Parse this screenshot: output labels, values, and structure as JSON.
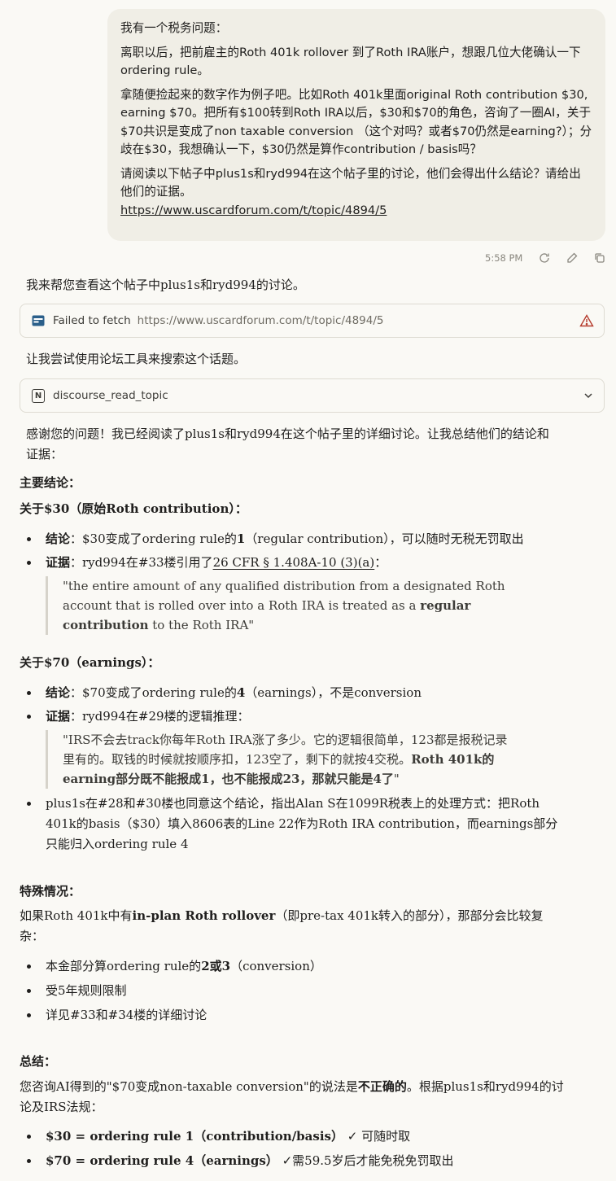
{
  "user_message": {
    "line1": "我有一个税务问题：",
    "para2": "离职以后，把前雇主的Roth 401k rollover 到了Roth IRA账户，想跟几位大佬确认一下ordering rule。",
    "para3": "拿随便捡起来的数字作为例子吧。比如Roth 401k里面original Roth contribution $30, earning $70。把所有$100转到Roth IRA以后，$30和$70的角色，咨询了一圈AI，关于$70共识是变成了non taxable conversion （这个对吗？或者$70仍然是earning?）；分歧在$30，我想确认一下，$30仍然是算作contribution / basis吗？",
    "para4": "请阅读以下帖子中plus1s和ryd994在这个帖子里的讨论，他们会得出什么结论？请给出他们的证据。",
    "link": "https://www.uscardforum.com/t/topic/4894/5",
    "time": "5:58 PM"
  },
  "meta_icons": [
    "retry-icon",
    "edit-icon",
    "copy-icon"
  ],
  "assistant": {
    "intro": "我来帮您查看这个帖子中plus1s和ryd994的讨论。",
    "fetch": {
      "status": "Failed to fetch",
      "url": "https://www.uscardforum.com/t/topic/4894/5"
    },
    "retry_text": "让我尝试使用论坛工具来搜索这个话题。",
    "tool": {
      "name": "discourse_read_topic",
      "badge": "N"
    },
    "thanks_line1": "感谢您的问题！我已经阅读了plus1s和ryd994在这个帖子里的详细讨论。让我总结他们的结论和",
    "thanks_line2": "证据：",
    "main_heading": "主要结论：",
    "s30": {
      "heading": "关于$30（原始Roth contribution）：",
      "conclusion_label": "结论",
      "conclusion_pre": "：$30变成了ordering rule的",
      "conclusion_bold": "1",
      "conclusion_post": "（regular contribution），可以随时无税无罚取出",
      "evidence_label": "证据",
      "evidence_pre": "：ryd994在#33楼引用了",
      "evidence_link": "26 CFR § 1.408A-10 (3)(a)",
      "evidence_post": "：",
      "quote_pre": "\"the entire amount of any qualified distribution from a designated Roth account that is rolled over into a Roth IRA is treated as a ",
      "quote_bold": "regular contribution",
      "quote_post": " to the Roth IRA\""
    },
    "s70": {
      "heading": "关于$70（earnings）：",
      "conclusion_label": "结论",
      "conclusion_pre": "：$70变成了ordering rule的",
      "conclusion_bold": "4",
      "conclusion_post": "（earnings），不是conversion",
      "evidence_label": "证据",
      "evidence_text": "：ryd994在#29楼的逻辑推理：",
      "quote_pre": "\"IRS不会去track你每年Roth IRA涨了多少。它的逻辑很简单，123都是报税记录里有的。取钱的时候就按顺序扣，123空了，剩下的就按4交税。",
      "quote_bold": "Roth 401k的earning部分既不能报成1，也不能报成23，那就只能是4了",
      "quote_post": "\"",
      "plus1s": "plus1s在#28和#30楼也同意这个结论，指出Alan S在1099R税表上的处理方式：把Roth 401k的basis（$30）填入8606表的Line 22作为Roth IRA contribution，而earnings部分只能归入ordering rule 4"
    },
    "special": {
      "heading": "特殊情况：",
      "para_pre": "如果Roth 401k中有",
      "para_bold": "in-plan Roth rollover",
      "para_post": "（即pre-tax 401k转入的部分），那部分会比较复杂：",
      "item1_pre": "本金部分算ordering rule的",
      "item1_bold": "2或3",
      "item1_post": "（conversion）",
      "item2": "受5年规则限制",
      "item3": "详见#33和#34楼的详细讨论"
    },
    "summary": {
      "heading": "总结：",
      "para_pre": "您咨询AI得到的\"$70变成non-taxable conversion\"的说法是",
      "para_bold": "不正确的",
      "para_post": "。根据plus1s和ryd994的讨论及IRS法规：",
      "item1_bold": "$30 = ordering rule 1（contribution/basis）",
      "item1_post": " ✓ 可随时取",
      "item2_bold": "$70 = ordering rule 4（earnings）",
      "item2_post": " ✓需59.5岁后才能免税免罚取出"
    }
  }
}
